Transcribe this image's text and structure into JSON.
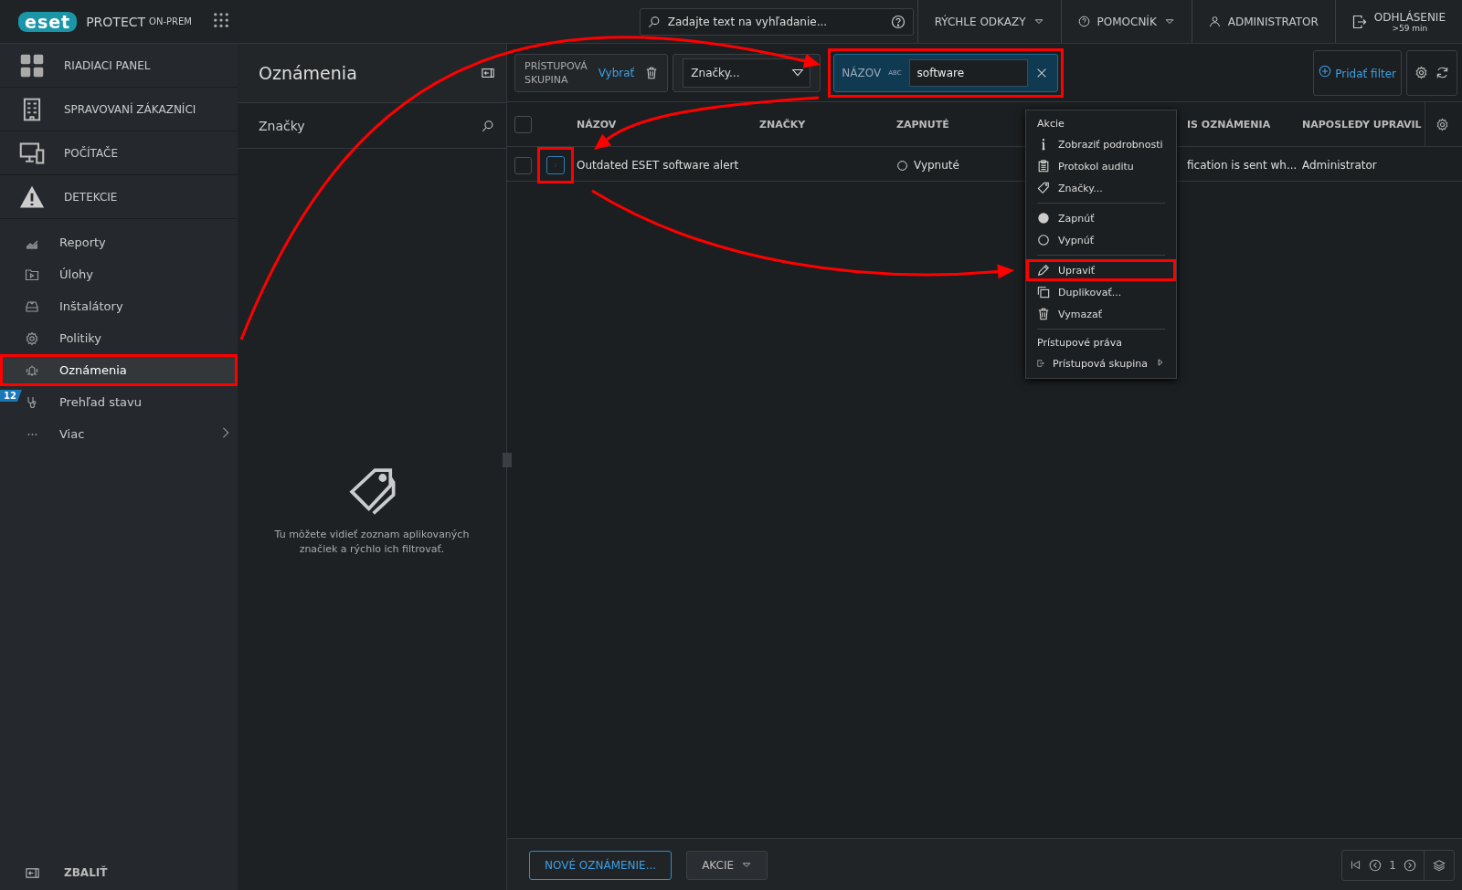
{
  "header": {
    "logo": "eset",
    "product": "PROTECT",
    "edition": "ON-PREM",
    "search": {
      "placeholder": "Zadajte text na vyhľadanie..."
    },
    "menus": [
      {
        "label": "RÝCHLE ODKAZY",
        "kind": "dropdown"
      },
      {
        "label": "POMOCNÍK",
        "kind": "help"
      },
      {
        "label": "ADMINISTRATOR",
        "kind": "user"
      }
    ],
    "logout": {
      "label": "ODHLÁSENIE",
      "sublabel": ">59 min"
    }
  },
  "sidebar": {
    "main_items": [
      {
        "label": "RIADIACI PANEL"
      },
      {
        "label": "SPRAVOVANÍ ZÁKAZNÍCI"
      },
      {
        "label": "POČÍTAČE"
      },
      {
        "label": "DETEKCIE"
      }
    ],
    "items": [
      {
        "label": "Reporty",
        "selected": false,
        "highlighted": false
      },
      {
        "label": "Úlohy",
        "selected": false,
        "highlighted": false
      },
      {
        "label": "Inštalátory",
        "selected": false,
        "highlighted": false
      },
      {
        "label": "Politiky",
        "selected": false,
        "highlighted": false
      },
      {
        "label": "Oznámenia",
        "selected": true,
        "highlighted": true
      },
      {
        "label": "Prehľad stavu",
        "selected": false,
        "highlighted": false,
        "badge": "12"
      },
      {
        "label": "Viac",
        "selected": false,
        "highlighted": false,
        "expandable": true
      }
    ],
    "collapse": "ZBALIŤ"
  },
  "tags_panel": {
    "title": "Oznámenia",
    "search_label": "Značky",
    "empty_text": "Tu môžete vidieť zoznam aplikovaných značiek a rýchlo ich filtrovať."
  },
  "filters": {
    "group": {
      "label": "PRÍSTUPOVÁ SKUPINA",
      "action": "Vybrať"
    },
    "tags": {
      "label": "Značky..."
    },
    "name_filter": {
      "label": "NÁZOV",
      "type_hint": "ABC",
      "value": "software",
      "highlighted": true
    },
    "add_filter": "Pridať filter"
  },
  "table": {
    "all_checked": false,
    "columns": [
      "NÁZOV",
      "ZNAČKY",
      "ZAPNUTÉ",
      "IS OZNÁMENIA",
      "NAPOSLEDY UPRAVIL"
    ],
    "rows": [
      {
        "checked": false,
        "menu_highlighted": true,
        "name": "Outdated ESET software alert",
        "enabled": false,
        "enabled_label": "Vypnuté",
        "description": "fication is sent wh...",
        "modified_by": "Administrator"
      }
    ]
  },
  "context_menu": {
    "sections": [
      {
        "title": "Akcie",
        "items": [
          {
            "label": "Zobraziť podrobnosti",
            "highlighted": false
          },
          {
            "label": "Protokol auditu",
            "highlighted": false
          },
          {
            "label": "Značky...",
            "highlighted": false
          }
        ]
      },
      {
        "items": [
          {
            "label": "Zapnúť",
            "highlighted": false
          },
          {
            "label": "Vypnúť",
            "highlighted": false
          }
        ]
      },
      {
        "items": [
          {
            "label": "Upraviť",
            "highlighted": true
          },
          {
            "label": "Duplikovať...",
            "highlighted": false
          },
          {
            "label": "Vymazať",
            "highlighted": false
          }
        ]
      },
      {
        "title": "Prístupové práva",
        "items": [
          {
            "label": "Prístupová skupina",
            "highlighted": false,
            "submenu": true
          }
        ]
      }
    ]
  },
  "footer": {
    "buttons": [
      {
        "label": "NOVÉ OZNÁMENIE...",
        "kind": "primary"
      },
      {
        "label": "AKCIE",
        "kind": "dropdown"
      }
    ],
    "page": "1"
  }
}
